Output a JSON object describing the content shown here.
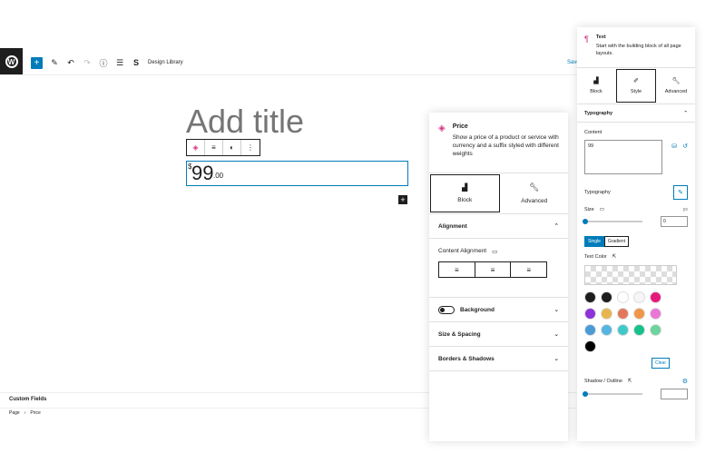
{
  "toolbar": {
    "design_library_label": "Design Library",
    "save_label": "Save"
  },
  "editor": {
    "title_placeholder": "Add title",
    "price": {
      "currency": "$",
      "amount": "99",
      "decimals": ".00"
    }
  },
  "footer": {
    "custom_fields": "Custom Fields",
    "breadcrumb": [
      "Page",
      "Price"
    ]
  },
  "price_panel": {
    "name": "Price",
    "description": "Show a price of a product or service with currency and a suffix styled with different weights",
    "tabs": [
      "Block",
      "Advanced"
    ],
    "sections": {
      "alignment": "Alignment",
      "content_alignment": "Content Alignment",
      "background": "Background",
      "size_spacing": "Size & Spacing",
      "borders_shadows": "Borders & Shadows"
    }
  },
  "text_panel": {
    "name": "Text",
    "description": "Start with the building block of all page layouts.",
    "tabs": [
      "Block",
      "Style",
      "Advanced"
    ],
    "typography_section": "Typography",
    "content_label": "Content",
    "content_value": "99",
    "typography_label": "Typography",
    "size_label": "Size",
    "size_unit": "px",
    "size_value": "0",
    "color_modes": [
      "Single",
      "Gradient"
    ],
    "text_color_label": "Text Color",
    "clear_label": "Clear",
    "shadow_label": "Shadow / Outline",
    "swatch_colors": [
      "#1e1e1e",
      "#1e1e1e",
      "#ffffff",
      "#f5f5f5",
      "#e5197a",
      "#8d33d9",
      "#e7b44f",
      "#e3775c",
      "#f19549",
      "#e977d6",
      "#4a9ad5",
      "#56b4e0",
      "#3fc8c8",
      "#18c18c",
      "#6ed39c",
      "#000000"
    ]
  },
  "colors": {
    "accent": "#007cba",
    "brand_pink": "#d63384"
  }
}
